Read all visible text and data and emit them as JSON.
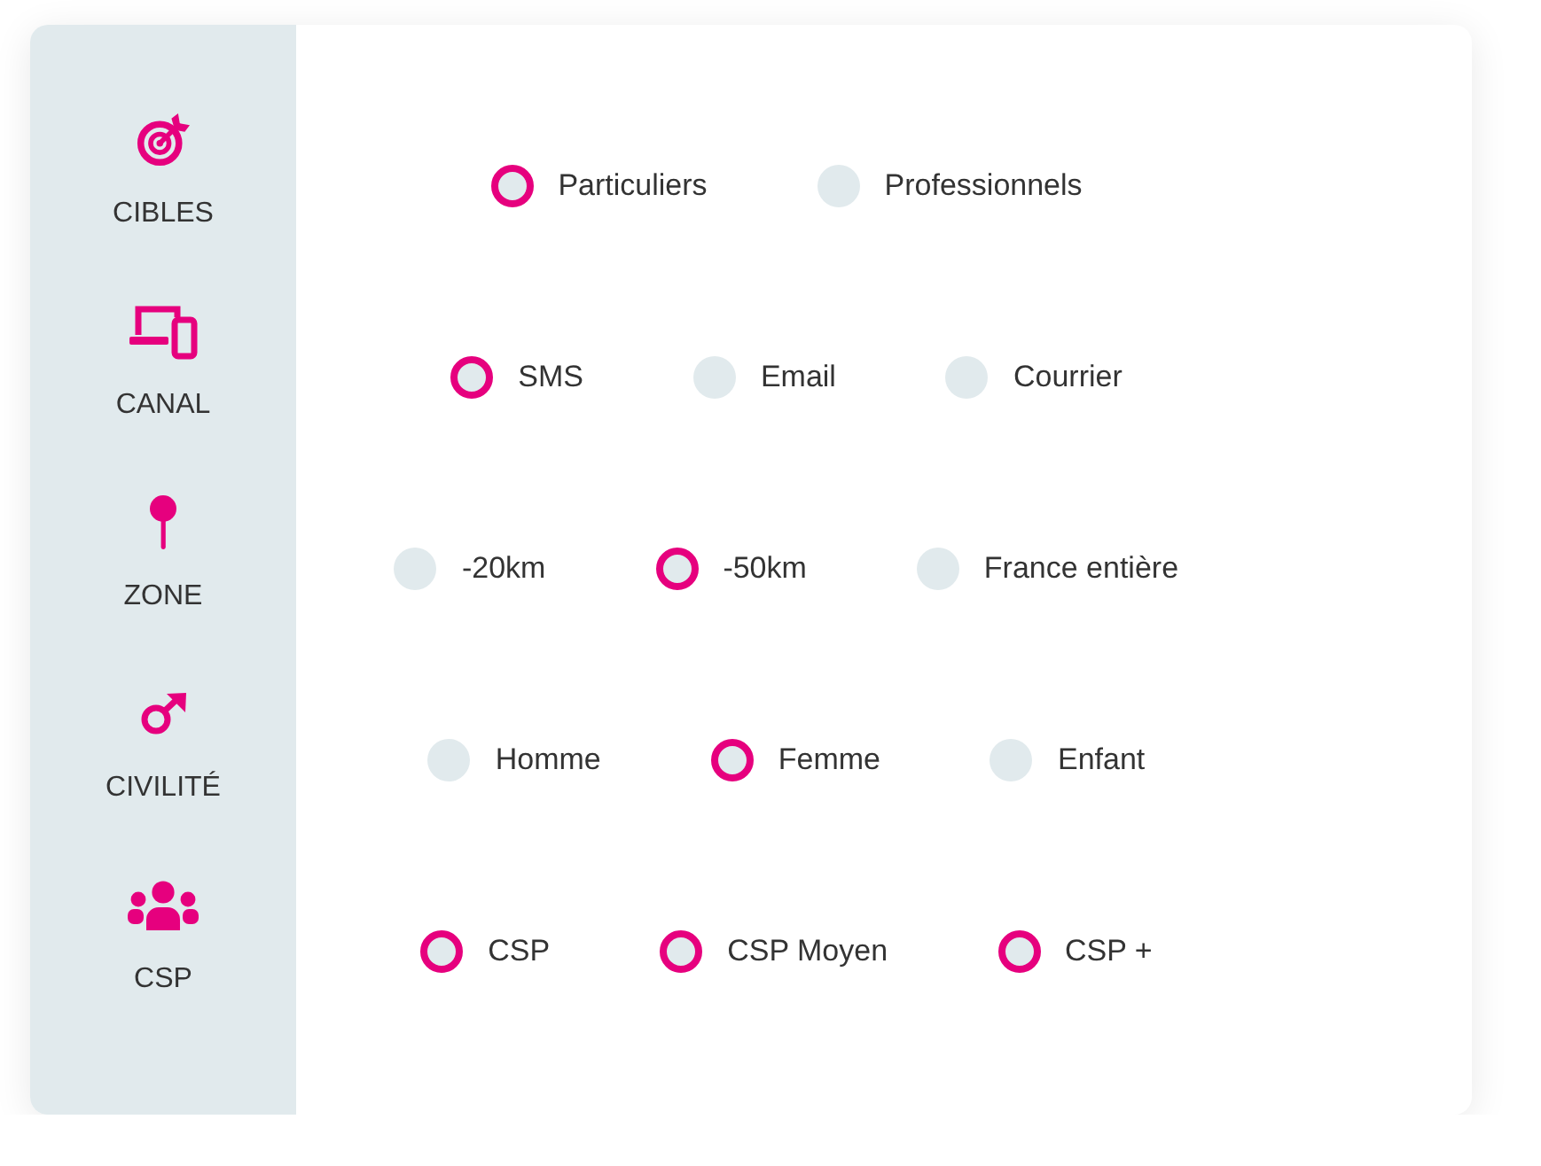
{
  "sidebar": {
    "items": [
      {
        "label": "CIBLES"
      },
      {
        "label": "CANAL"
      },
      {
        "label": "ZONE"
      },
      {
        "label": "CIVILITÉ"
      },
      {
        "label": "CSP"
      }
    ]
  },
  "option_groups": [
    {
      "options": [
        {
          "label": "Particuliers",
          "selected": true
        },
        {
          "label": "Professionnels",
          "selected": false
        }
      ]
    },
    {
      "options": [
        {
          "label": "SMS",
          "selected": true
        },
        {
          "label": "Email",
          "selected": false
        },
        {
          "label": "Courrier",
          "selected": false
        }
      ]
    },
    {
      "options": [
        {
          "label": "-20km",
          "selected": false
        },
        {
          "label": "-50km",
          "selected": true
        },
        {
          "label": "France entière",
          "selected": false
        }
      ]
    },
    {
      "options": [
        {
          "label": "Homme",
          "selected": false
        },
        {
          "label": "Femme",
          "selected": true
        },
        {
          "label": "Enfant",
          "selected": false
        }
      ]
    },
    {
      "options": [
        {
          "label": "CSP",
          "selected": true
        },
        {
          "label": "CSP Moyen",
          "selected": true
        },
        {
          "label": "CSP +",
          "selected": true
        }
      ]
    }
  ]
}
